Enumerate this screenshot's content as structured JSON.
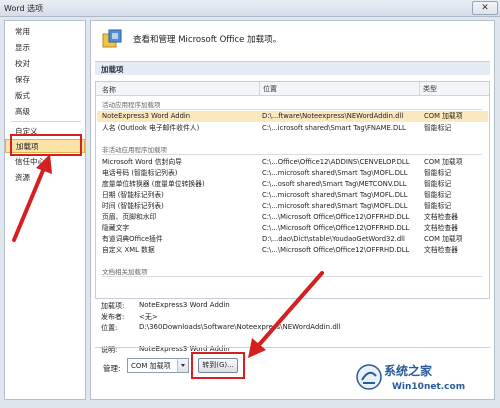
{
  "window": {
    "title": "Word 选项",
    "close_glyph": "✕"
  },
  "sidebar": {
    "items": [
      {
        "label": "常用"
      },
      {
        "label": "显示"
      },
      {
        "label": "校对"
      },
      {
        "label": "保存"
      },
      {
        "label": "版式"
      },
      {
        "label": "高级"
      },
      {
        "label": "自定义"
      },
      {
        "label": "加载项"
      },
      {
        "label": "信任中心"
      },
      {
        "label": "资源"
      }
    ],
    "selected_index": 7
  },
  "main": {
    "header_text": "查看和管理 Microsoft Office 加载项。",
    "section_title": "加载项",
    "columns": {
      "name": "名称",
      "location": "位置",
      "type": "类型"
    },
    "groups": [
      {
        "title": "活动应用程序加载项",
        "rows": [
          {
            "name": "NoteExpress3 Word Addin",
            "location": "D:\\...ftware\\Noteexpress\\NEWordAddin.dll",
            "type": "COM 加载项"
          },
          {
            "name": "人名 (Outlook 电子邮件收件人)",
            "location": "C:\\...icrosoft shared\\Smart Tag\\FNAME.DLL",
            "type": "智能标记"
          }
        ]
      },
      {
        "title": "非活动应用程序加载项",
        "rows": [
          {
            "name": "Microsoft Word 信封向导",
            "location": "C:\\...Office\\Office12\\ADDINS\\CENVELOP.DLL",
            "type": "COM 加载项"
          },
          {
            "name": "电话号码 (智能标记列表)",
            "location": "C:\\...microsoft shared\\Smart Tag\\MOFL.DLL",
            "type": "智能标记"
          },
          {
            "name": "度量单位转换器 (度量单位转换器)",
            "location": "C:\\...osoft shared\\Smart Tag\\METCONV.DLL",
            "type": "智能标记"
          },
          {
            "name": "日期 (智能标记列表)",
            "location": "C:\\...microsoft shared\\Smart Tag\\MOFL.DLL",
            "type": "智能标记"
          },
          {
            "name": "时间 (智能标记列表)",
            "location": "C:\\...microsoft shared\\Smart Tag\\MOFL.DLL",
            "type": "智能标记"
          },
          {
            "name": "页眉、页脚和水印",
            "location": "C:\\...\\Microsoft Office\\Office12\\OFFRHD.DLL",
            "type": "文档检查器"
          },
          {
            "name": "隐藏文字",
            "location": "C:\\...\\Microsoft Office\\Office12\\OFFRHD.DLL",
            "type": "文档检查器"
          },
          {
            "name": "有道词典Office插件",
            "location": "D:\\...dao\\Dict\\stable\\YoudaoGetWord32.dll",
            "type": "COM 加载项"
          },
          {
            "name": "自定义 XML 数据",
            "location": "C:\\...\\Microsoft Office\\Office12\\OFFRHD.DLL",
            "type": "文档检查器"
          }
        ]
      },
      {
        "title": "文档相关加载项",
        "rows": []
      }
    ],
    "details": {
      "addin_label": "加载项:",
      "addin_value": "NoteExpress3 Word Addin",
      "publisher_label": "发布者:",
      "publisher_value": "<无>",
      "location_label": "位置:",
      "location_value": "D:\\360Downloads\\Software\\Noteexpress\\NEWordAddin.dll",
      "desc_label": "说明:",
      "desc_value": "NoteExpress3 Word Addin"
    },
    "manage": {
      "label": "管理:",
      "selected": "COM 加载项",
      "go_button": "转到(G)..."
    }
  },
  "watermark": {
    "line1": "系统之家",
    "line2": "Win10net.com"
  },
  "colors": {
    "accent_red": "#d42020",
    "selection": "#fbe3a8",
    "watermark_blue": "#2a5b9a"
  }
}
